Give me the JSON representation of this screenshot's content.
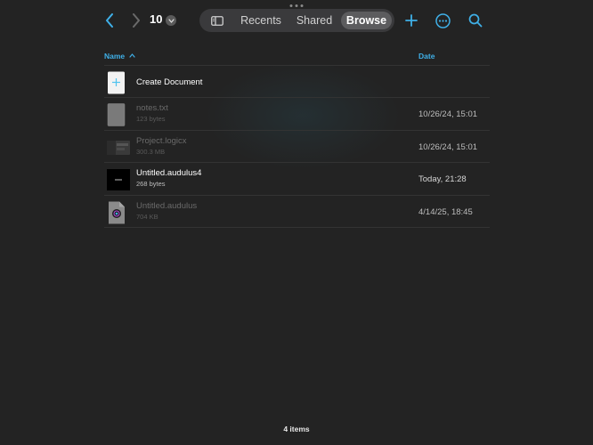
{
  "toolbar": {
    "folder_title": "10",
    "tabs": [
      {
        "label": "Recents",
        "selected": false
      },
      {
        "label": "Shared",
        "selected": false
      },
      {
        "label": "Browse",
        "selected": true
      }
    ],
    "icons": [
      "chevron-left-icon",
      "chevron-right-icon",
      "chevron-down-icon",
      "sidebar-icon",
      "plus-icon",
      "ellipsis-circle-icon",
      "search-icon"
    ],
    "accent_color": "#3fb0e8"
  },
  "columns": {
    "name": "Name",
    "date": "Date",
    "sort": "ascending"
  },
  "create_document": {
    "label": "Create Document"
  },
  "files": [
    {
      "name": "notes.txt",
      "size": "123 bytes",
      "date": "10/26/24, 15:01",
      "enabled": false,
      "icon": "text-file-icon"
    },
    {
      "name": "Project.logicx",
      "size": "300.3 MB",
      "date": "10/26/24, 15:01",
      "enabled": false,
      "icon": "logic-project-icon"
    },
    {
      "name": "Untitled.audulus4",
      "size": "268 bytes",
      "date": "Today, 21:28",
      "enabled": true,
      "icon": "audulus4-file-icon"
    },
    {
      "name": "Untitled.audulus",
      "size": "704 KB",
      "date": "4/14/25, 18:45",
      "enabled": false,
      "icon": "audulus-file-icon"
    }
  ],
  "footer": {
    "item_count": "4 items"
  }
}
